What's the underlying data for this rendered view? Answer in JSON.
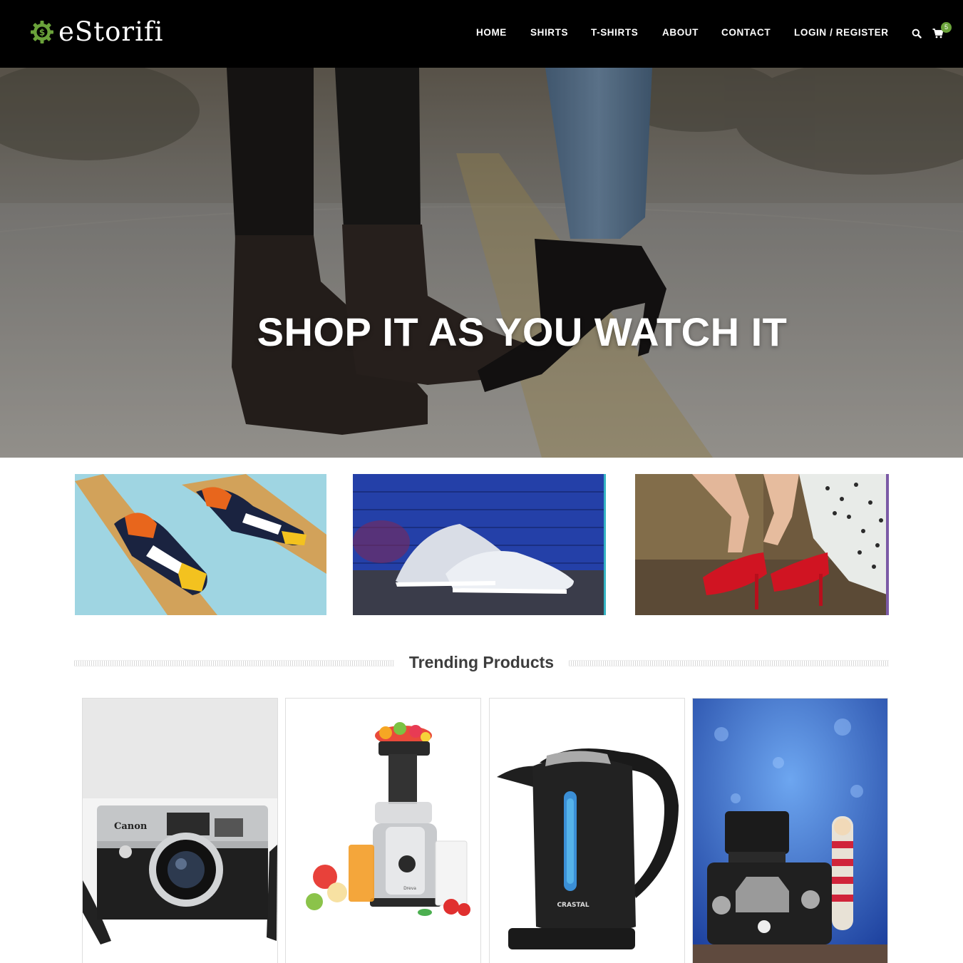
{
  "brand": {
    "name": "eStorifi",
    "accent": "#6aa23a"
  },
  "nav": {
    "items": [
      "HOME",
      "SHIRTS",
      "T-SHIRTS",
      "ABOUT",
      "CONTACT",
      "LOGIN / REGISTER"
    ],
    "search_icon": "search-icon",
    "cart_icon": "cart-icon",
    "cart_count": "5"
  },
  "hero": {
    "title": "SHOP IT AS YOU WATCH IT"
  },
  "banners": [
    {
      "name": "sneakers-on-wood-banner"
    },
    {
      "name": "white-runners-blue-wall-banner"
    },
    {
      "name": "red-heels-banner"
    }
  ],
  "trending": {
    "title": "Trending Products",
    "products": [
      {
        "name": "retro-canon-camera",
        "brand_text": "Canon"
      },
      {
        "name": "slow-juicer",
        "brand_text": "Dreva"
      },
      {
        "name": "electric-kettle",
        "brand_text": "CRASTAL"
      },
      {
        "name": "dslr-camera-with-toy",
        "brand_text": ""
      }
    ]
  }
}
